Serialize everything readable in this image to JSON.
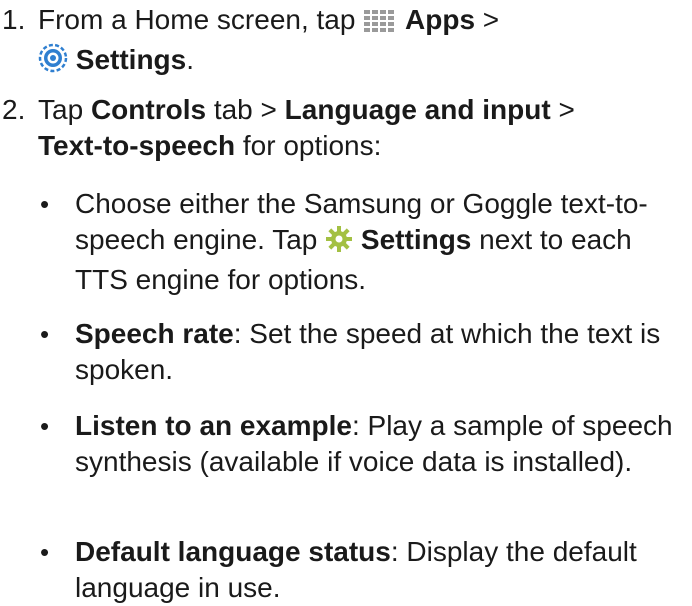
{
  "steps": [
    {
      "number": "1.",
      "from": "From a Home screen, tap ",
      "apps": "Apps",
      "gt": " >",
      "settings": "Settings",
      "period": "."
    },
    {
      "number": "2.",
      "tap": "Tap ",
      "controls": "Controls",
      "tab": " tab > ",
      "language": "Language and input",
      "gt": " >",
      "tts": "Text-to-speech",
      "options": " for options:"
    }
  ],
  "bullets": [
    {
      "bullet": "•",
      "lead": "Choose either the Samsung or Goggle text-to-speech engine. Tap ",
      "settings": "Settings",
      "tail": " next to each TTS engine for options."
    },
    {
      "bullet": "•",
      "term": "Speech rate",
      "desc": ": Set the speed at which the text is spoken."
    },
    {
      "bullet": "•",
      "term": "Listen to an example",
      "desc": ": Play a sample of speech synthesis (available if voice data is installed)."
    },
    {
      "bullet": "•",
      "term": "Default language status",
      "desc": ": Display the default language in use."
    }
  ],
  "icons": {
    "apps": "apps-grid-icon",
    "settings_app": "settings-app-icon",
    "settings_gear": "gear-icon"
  },
  "colors": {
    "text": "#1a1a1a",
    "settings_icon": "#2f7fd0",
    "gear": "#a3c043"
  }
}
